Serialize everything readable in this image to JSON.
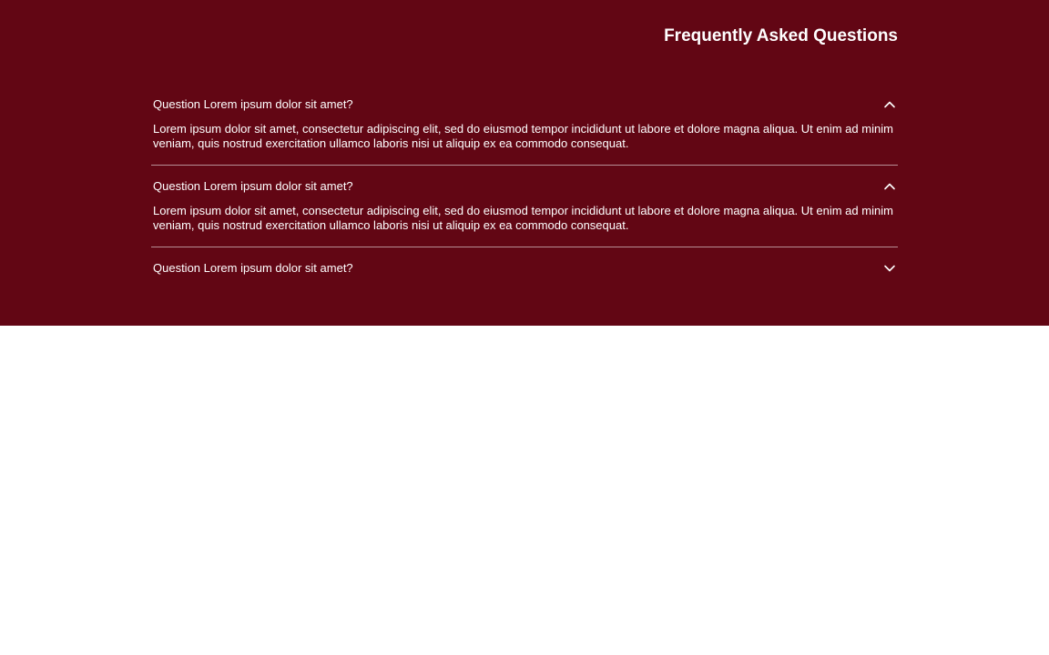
{
  "theme": {
    "section_bg": "#620614",
    "text_color": "#ffffff",
    "page_bg": "#ffffff"
  },
  "faq": {
    "title": "Frequently Asked Questions",
    "items": [
      {
        "question": "Question Lorem ipsum dolor sit amet?",
        "answer": "Lorem ipsum dolor sit amet, consectetur adipiscing elit, sed do eiusmod tempor incididunt ut labore et dolore magna aliqua. Ut enim ad minim veniam, quis nostrud exercitation ullamco laboris nisi ut aliquip ex ea commodo consequat.",
        "expanded": true,
        "icon": "chevron-up-icon"
      },
      {
        "question": "Question Lorem ipsum dolor sit amet?",
        "answer": "Lorem ipsum dolor sit amet, consectetur adipiscing elit, sed do eiusmod tempor incididunt ut labore et dolore magna aliqua. Ut enim ad minim veniam, quis nostrud exercitation ullamco laboris nisi ut aliquip ex ea commodo consequat.",
        "expanded": true,
        "icon": "chevron-up-icon"
      },
      {
        "question": "Question Lorem ipsum dolor sit amet?",
        "answer": "",
        "expanded": false,
        "icon": "chevron-down-icon"
      }
    ]
  }
}
